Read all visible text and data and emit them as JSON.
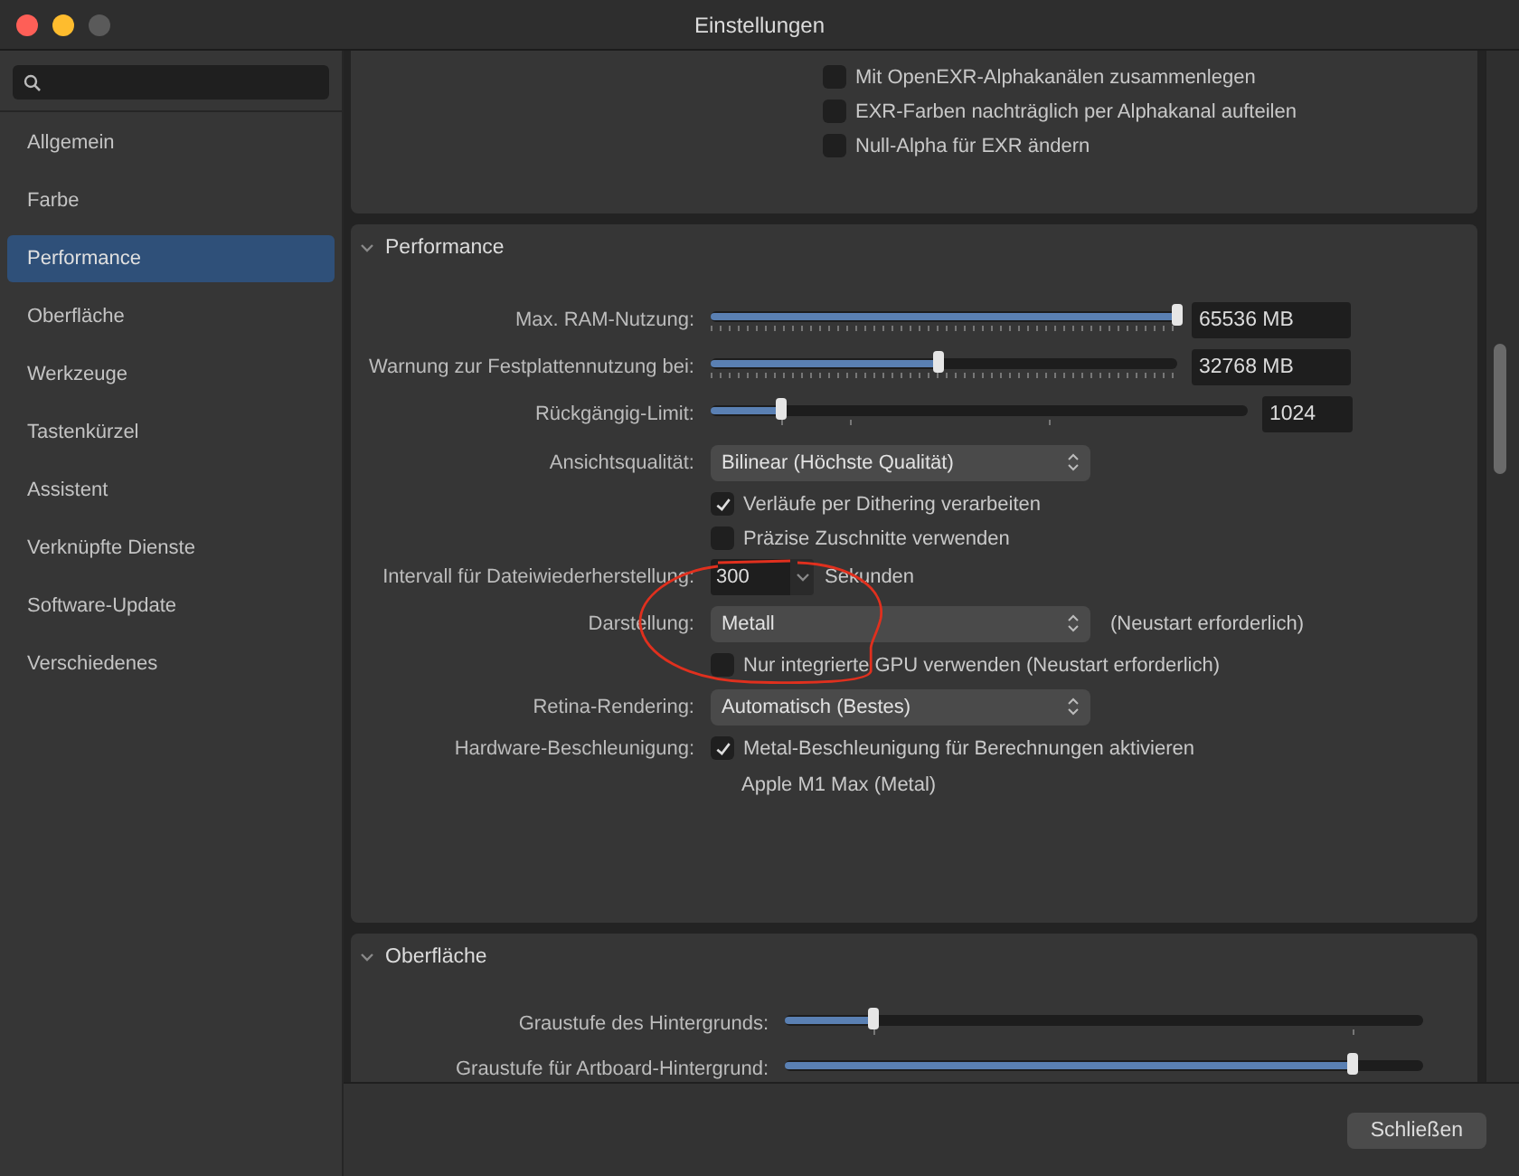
{
  "window": {
    "title": "Einstellungen"
  },
  "sidebar": {
    "items": [
      {
        "label": "Allgemein",
        "selected": false
      },
      {
        "label": "Farbe",
        "selected": false
      },
      {
        "label": "Performance",
        "selected": true
      },
      {
        "label": "Oberfläche",
        "selected": false
      },
      {
        "label": "Werkzeuge",
        "selected": false
      },
      {
        "label": "Tastenkürzel",
        "selected": false
      },
      {
        "label": "Assistent",
        "selected": false
      },
      {
        "label": "Verknüpfte Dienste",
        "selected": false
      },
      {
        "label": "Software-Update",
        "selected": false
      },
      {
        "label": "Verschiedenes",
        "selected": false
      }
    ]
  },
  "top_section": {
    "options": [
      {
        "text": "Mit OpenEXR-Alphakanälen zusammenlegen",
        "checked": false
      },
      {
        "text": "EXR-Farben nachträglich per Alphakanal aufteilen",
        "checked": false
      },
      {
        "text": "Null-Alpha für EXR ändern",
        "checked": false
      }
    ]
  },
  "sections": [
    {
      "title": "Performance",
      "expanded": true,
      "rows": [
        {
          "kind": "scale",
          "label": "Max. RAM-Nutzung:",
          "level": 1.0,
          "value": "65536 MB"
        },
        {
          "kind": "scale",
          "label": "Warnung zur Festplattennutzung bei:",
          "level": 0.49,
          "value": "32768 MB"
        },
        {
          "kind": "slider",
          "label": "Rückgängig-Limit:",
          "level": 0.13,
          "value": "1024"
        },
        {
          "kind": "select",
          "label": "Ansichtsqualität:",
          "value": "Bilinear (Höchste Qualität)"
        },
        {
          "kind": "checkbox",
          "text": "Verläufe per Dithering verarbeiten",
          "checked": true
        },
        {
          "kind": "checkbox",
          "text": "Präzise Zuschnitte verwenden",
          "checked": false
        },
        {
          "kind": "stepper",
          "label": "Intervall für Dateiwiederherstellung:",
          "value": "300",
          "unit": "Sekunden"
        },
        {
          "kind": "select",
          "label": "Darstellung:",
          "value": "Metall",
          "note": "(Neustart erforderlich)"
        },
        {
          "kind": "checkbox",
          "text": "Nur integrierte GPU verwenden (Neustart erforderlich)",
          "checked": false
        },
        {
          "kind": "select",
          "label": "Retina-Rendering:",
          "value": "Automatisch (Bestes)"
        },
        {
          "kind": "checkbox",
          "label": "Hardware-Beschleunigung:",
          "text": "Metal-Beschleunigung für Berechnungen aktivieren",
          "checked": true
        },
        {
          "kind": "info",
          "text": "Apple M1 Max (Metal)"
        }
      ]
    },
    {
      "title": "Oberfläche",
      "expanded": true,
      "rows": [
        {
          "kind": "slider",
          "label": "Graustufe des Hintergrunds:",
          "level": 0.14
        },
        {
          "kind": "slider",
          "label": "Graustufe für Artboard-Hintergrund:",
          "level": 0.89
        }
      ]
    }
  ],
  "footer": {
    "buttons": [
      "Schließen"
    ]
  }
}
